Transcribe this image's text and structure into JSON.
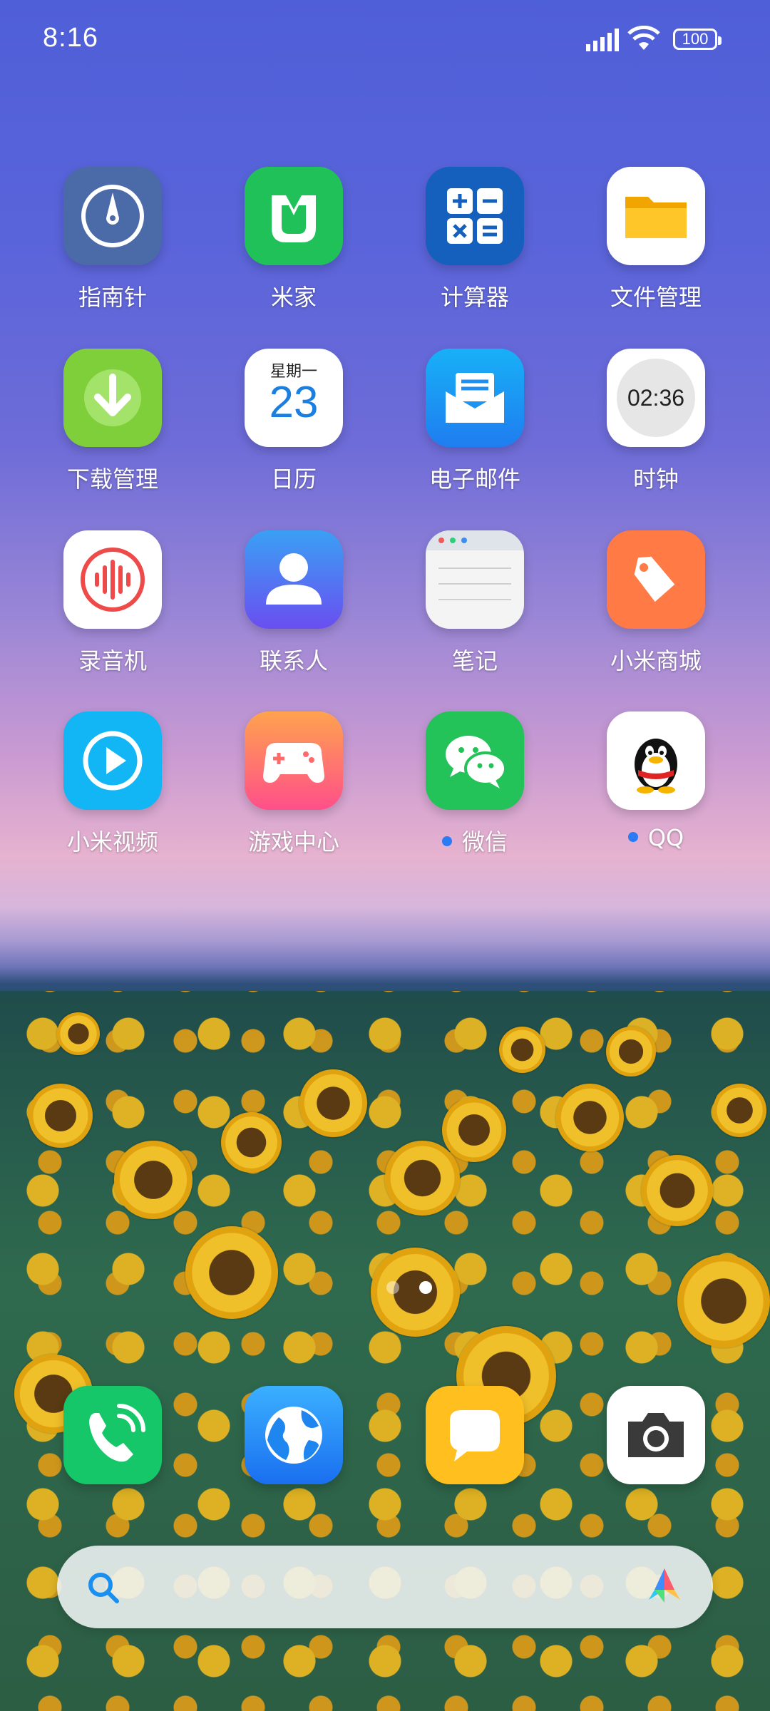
{
  "status_bar": {
    "time": "8:16",
    "battery": "100",
    "icons": [
      "signal-icon",
      "wifi-icon",
      "battery-icon"
    ]
  },
  "apps": [
    {
      "label": "指南针",
      "icon": "compass-icon",
      "color": "#4d6db0"
    },
    {
      "label": "米家",
      "icon": "mijia-icon",
      "color": "#21c15a"
    },
    {
      "label": "计算器",
      "icon": "calculator-icon",
      "color": "#1560bd"
    },
    {
      "label": "文件管理",
      "icon": "folder-icon",
      "color": "#ffc62a"
    },
    {
      "label": "下载管理",
      "icon": "download-icon",
      "color": "#7ecf3a"
    },
    {
      "label": "日历",
      "icon": "calendar-icon",
      "weekday": "星期一",
      "day": "23",
      "color": "#1a7fe0"
    },
    {
      "label": "电子邮件",
      "icon": "mail-icon",
      "color": "#1f9bf0"
    },
    {
      "label": "时钟",
      "icon": "clock-icon",
      "time": "02:36"
    },
    {
      "label": "录音机",
      "icon": "recorder-icon",
      "color": "#ef4a4a"
    },
    {
      "label": "联系人",
      "icon": "contacts-icon",
      "color": "#4a6ff0"
    },
    {
      "label": "笔记",
      "icon": "notes-icon"
    },
    {
      "label": "小米商城",
      "icon": "mi-store-icon",
      "color": "#ff7a45"
    },
    {
      "label": "小米视频",
      "icon": "video-icon",
      "color": "#13b6f5"
    },
    {
      "label": "游戏中心",
      "icon": "game-center-icon",
      "color": "#ff6a6a"
    },
    {
      "label": "微信",
      "icon": "wechat-icon",
      "color": "#23c35a",
      "notification_dot": true
    },
    {
      "label": "QQ",
      "icon": "qq-icon",
      "notification_dot": true
    }
  ],
  "page_indicator": {
    "pages": 2,
    "current": 2
  },
  "dock": [
    {
      "name": "phone",
      "icon": "phone-icon",
      "color": "#16c76a"
    },
    {
      "name": "browser",
      "icon": "browser-icon",
      "color": "#2a95f4"
    },
    {
      "name": "messages",
      "icon": "messages-icon",
      "color": "#ffbf1f"
    },
    {
      "name": "camera",
      "icon": "camera-icon",
      "color": "#ffffff"
    }
  ],
  "search_bar": {
    "icons": [
      "search-icon",
      "assistant-icon"
    ]
  }
}
